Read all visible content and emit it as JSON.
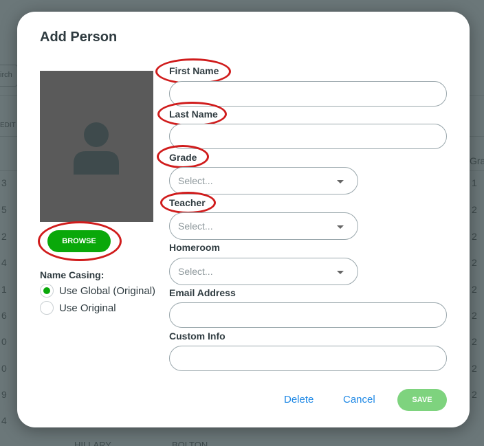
{
  "background": {
    "left_digits": [
      "3",
      "5",
      "2",
      "4",
      "1",
      "6",
      "0",
      "0",
      "9",
      "4"
    ],
    "right_digits": [
      "1",
      "2",
      "2",
      "2",
      "2",
      "2",
      "2",
      "2",
      "2"
    ],
    "header_fragment": "Gra",
    "left_fragment_1": "irch",
    "left_fragment_2": "EDIT",
    "bottom_text": [
      "HILLARY",
      "BOLTON"
    ]
  },
  "modal": {
    "title": "Add Person",
    "browse_label": "BROWSE",
    "name_casing": {
      "label": "Name Casing:",
      "options": [
        {
          "label": "Use Global (Original)",
          "checked": true
        },
        {
          "label": "Use Original",
          "checked": false
        }
      ]
    },
    "fields": {
      "first_name": {
        "label": "First Name",
        "value": ""
      },
      "last_name": {
        "label": "Last Name",
        "value": ""
      },
      "grade": {
        "label": "Grade",
        "placeholder": "Select..."
      },
      "teacher": {
        "label": "Teacher",
        "placeholder": "Select..."
      },
      "homeroom": {
        "label": "Homeroom",
        "placeholder": "Select..."
      },
      "email": {
        "label": "Email Address",
        "value": ""
      },
      "custom_info": {
        "label": "Custom Info",
        "value": ""
      }
    },
    "actions": {
      "delete": "Delete",
      "cancel": "Cancel",
      "save": "SAVE"
    }
  },
  "colors": {
    "accent_green": "#0aa80a",
    "save_green": "#7ed37e",
    "link_blue": "#1e88e5",
    "highlight_red": "#d01c1c"
  }
}
